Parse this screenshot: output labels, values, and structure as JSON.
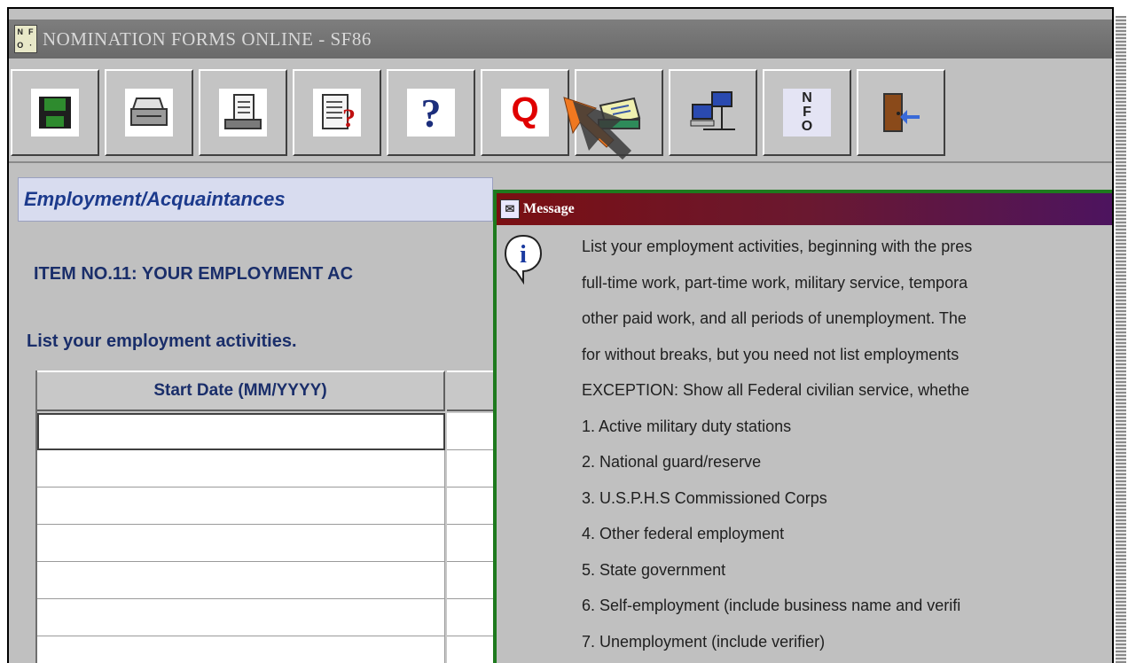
{
  "window": {
    "title": "NOMINATION FORMS ONLINE - SF86"
  },
  "app_icon": {
    "glyphs": [
      "N",
      "F",
      "O",
      "·"
    ]
  },
  "toolbar": {
    "buttons": [
      {
        "name": "save-button",
        "icon": "floppy-disk-icon"
      },
      {
        "name": "print-button",
        "icon": "printer-icon"
      },
      {
        "name": "preview-button",
        "icon": "document-preview-icon"
      },
      {
        "name": "form-help-button",
        "icon": "document-question-icon"
      },
      {
        "name": "help-button",
        "icon": "question-mark-icon",
        "glyph": "?"
      },
      {
        "name": "q-button",
        "icon": "q-icon",
        "glyph": "Q"
      },
      {
        "name": "mail-button",
        "icon": "envelope-tray-icon"
      },
      {
        "name": "network-button",
        "icon": "network-computers-icon"
      },
      {
        "name": "nfo-button",
        "icon": "nfo-logo-icon",
        "glyphs": [
          "N",
          "F",
          "O"
        ]
      },
      {
        "name": "exit-button",
        "icon": "exit-door-icon"
      }
    ]
  },
  "section": {
    "title": "Employment/Acquaintances",
    "item_label": "ITEM  NO.11: YOUR EMPLOYMENT AC",
    "instruction": "List your employment activities."
  },
  "table": {
    "columns": [
      "Start Date (MM/YYYY)",
      ""
    ],
    "row_count": 7
  },
  "message": {
    "title": "Message",
    "icon": "info-icon",
    "lines": [
      "List your employment activities, beginning with the pres",
      "full-time work, part-time work, military service, tempora",
      "other paid work, and all periods of unemployment. The",
      "for without breaks, but you need not list employments",
      "EXCEPTION: Show all Federal civilian service, whethe",
      "1. Active military duty stations",
      "2. National guard/reserve",
      "3. U.S.P.H.S Commissioned Corps",
      "4. Other federal employment",
      "5. State government",
      "6. Self-employment (include business name and verifi",
      "7. Unemployment (include verifier)"
    ]
  },
  "colors": {
    "accent_q": "#e00000",
    "dialog_border": "#1e7a1e",
    "cursor": "#f07820"
  }
}
